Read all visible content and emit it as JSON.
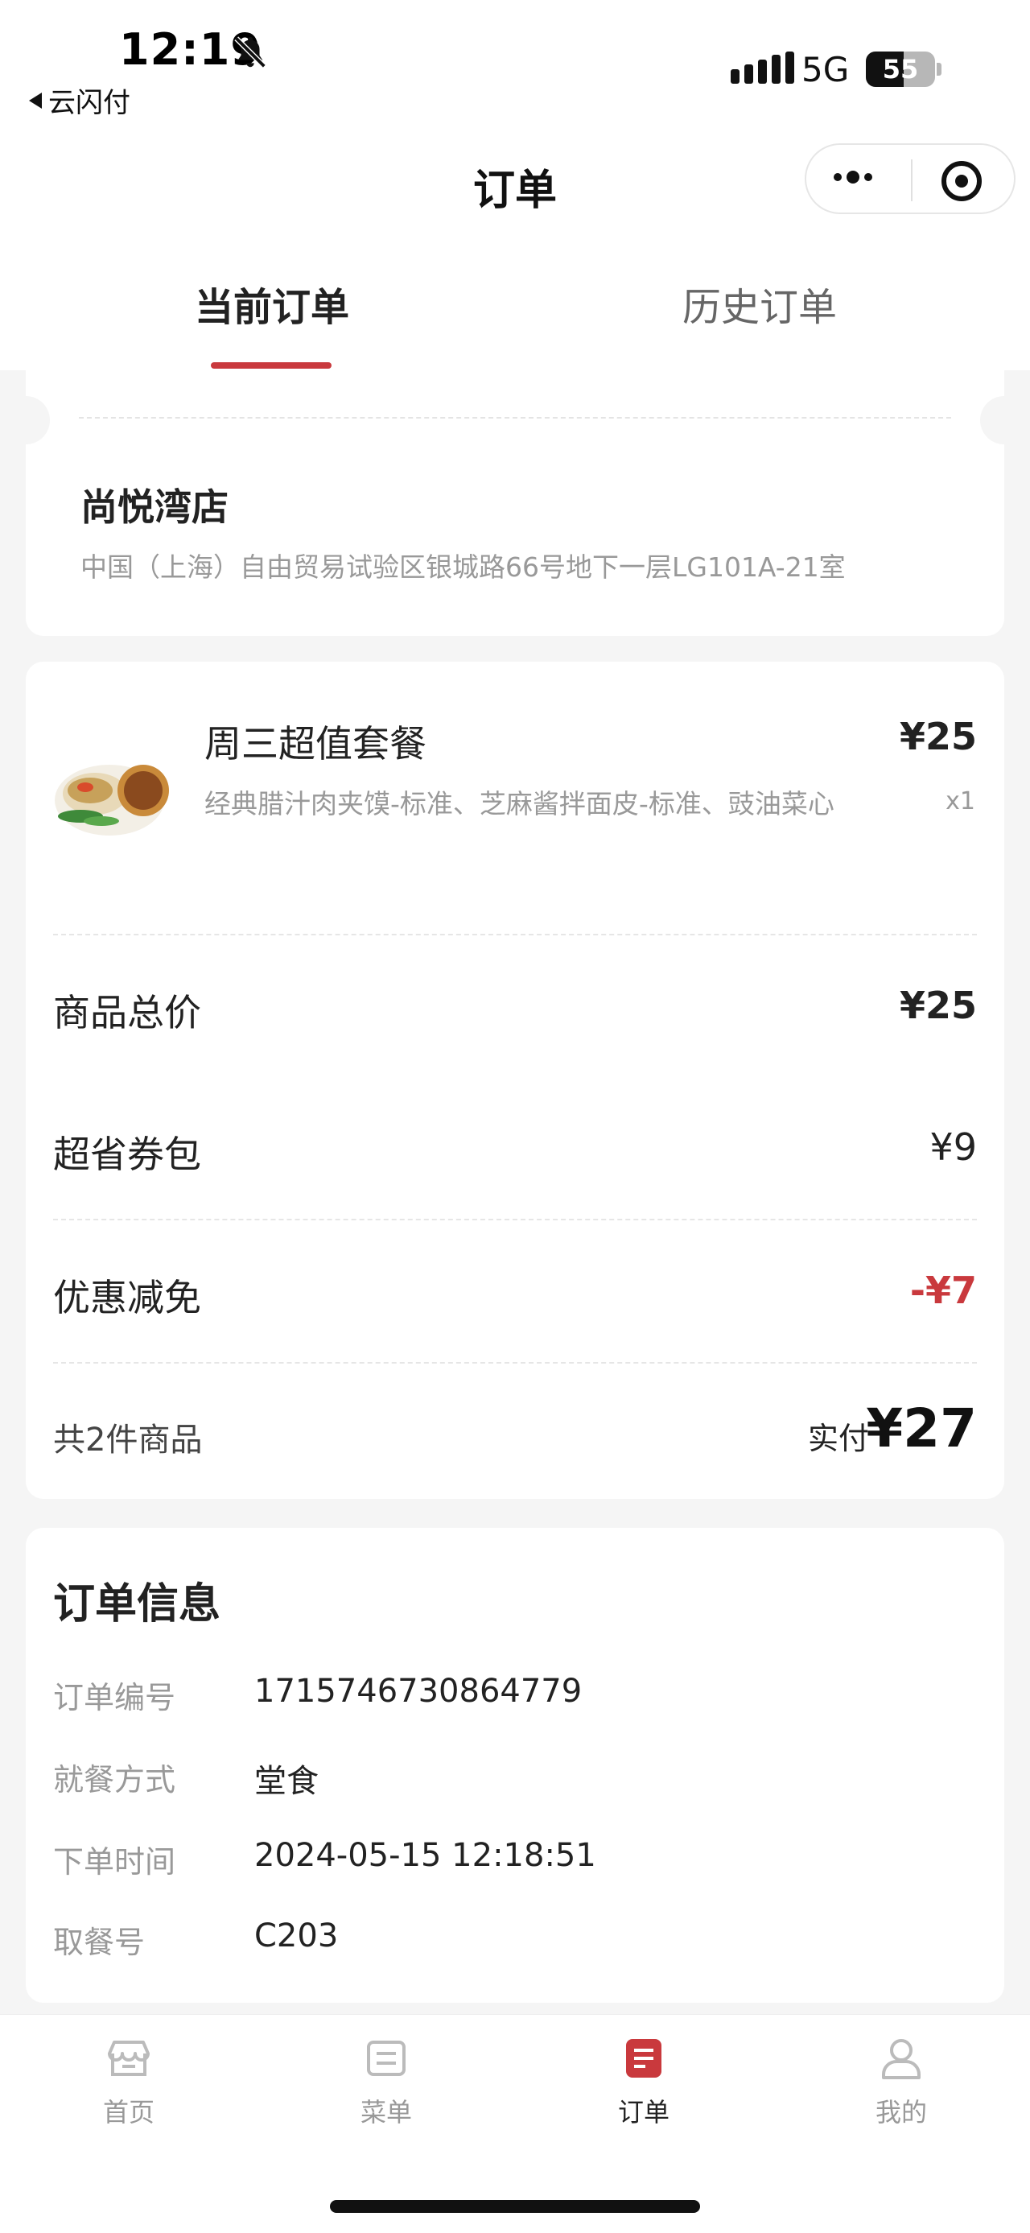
{
  "status_bar": {
    "time": "12:19",
    "back_app": "云闪付",
    "network": "5G",
    "battery": "55"
  },
  "navbar": {
    "title": "订单"
  },
  "tabs": [
    {
      "label": "当前订单",
      "active": true
    },
    {
      "label": "历史订单",
      "active": false
    }
  ],
  "store": {
    "name": "尚悦湾店",
    "address": "中国（上海）自由贸易试验区银城路66号地下一层LG101A-21室"
  },
  "order": {
    "item": {
      "name": "周三超值套餐",
      "price": "¥25",
      "desc": "经典腊汁肉夹馍-标准、芝麻酱拌面皮-标准、豉油菜心",
      "qty": "x1"
    },
    "rows": [
      {
        "label": "商品总价",
        "value": "¥25"
      },
      {
        "label": "超省券包",
        "value": "¥9"
      },
      {
        "label": "优惠减免",
        "value": "-¥7"
      }
    ],
    "count_label": "共2件商品",
    "paid_label": "实付",
    "paid_value": "¥27"
  },
  "order_info": {
    "title": "订单信息",
    "rows": [
      {
        "label": "订单编号",
        "value": "1715746730864779"
      },
      {
        "label": "就餐方式",
        "value": "堂食"
      },
      {
        "label": "下单时间",
        "value": "2024-05-15 12:18:51"
      },
      {
        "label": "取餐号",
        "value": "C203"
      }
    ]
  },
  "tabbar": [
    {
      "label": "首页",
      "icon": "store-icon"
    },
    {
      "label": "菜单",
      "icon": "menu-icon"
    },
    {
      "label": "订单",
      "icon": "order-icon",
      "active": true
    },
    {
      "label": "我的",
      "icon": "profile-icon"
    }
  ],
  "colors": {
    "accent": "#c9393d",
    "background": "#f5f5f5"
  }
}
